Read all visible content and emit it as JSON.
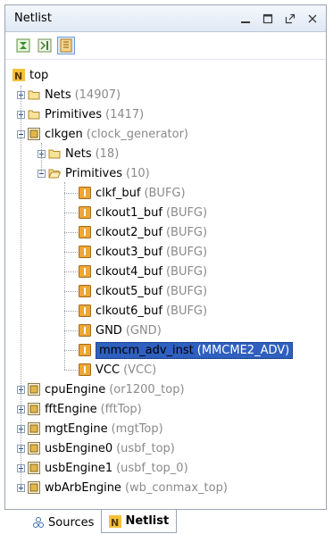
{
  "panel": {
    "title": "Netlist",
    "window_buttons": [
      "minimize-icon",
      "restore-icon",
      "float-icon",
      "close-icon"
    ]
  },
  "toolbar": {
    "buttons": [
      {
        "name": "collapse-all-icon",
        "active": false
      },
      {
        "name": "expand-icon",
        "active": false
      },
      {
        "name": "show-hierarchy-icon",
        "active": true
      }
    ]
  },
  "tree": {
    "root": "top",
    "top_nets": {
      "name": "Nets",
      "type": "(14907)"
    },
    "top_primitives": {
      "name": "Primitives",
      "type": "(1417)"
    },
    "clkgen": {
      "name": "clkgen",
      "type": "(clock_generator)"
    },
    "clkgen_nets": {
      "name": "Nets",
      "type": "(18)"
    },
    "clkgen_primitives": {
      "name": "Primitives",
      "type": "(10)"
    },
    "primitives": [
      {
        "name": "clkf_buf",
        "type": "(BUFG)"
      },
      {
        "name": "clkout1_buf",
        "type": "(BUFG)"
      },
      {
        "name": "clkout2_buf",
        "type": "(BUFG)"
      },
      {
        "name": "clkout3_buf",
        "type": "(BUFG)"
      },
      {
        "name": "clkout4_buf",
        "type": "(BUFG)"
      },
      {
        "name": "clkout5_buf",
        "type": "(BUFG)"
      },
      {
        "name": "clkout6_buf",
        "type": "(BUFG)"
      },
      {
        "name": "GND",
        "type": "(GND)"
      },
      {
        "name": "mmcm_adv_inst",
        "type": "(MMCME2_ADV)"
      },
      {
        "name": "VCC",
        "type": "(VCC)"
      }
    ],
    "modules": [
      {
        "name": "cpuEngine",
        "type": "(or1200_top)"
      },
      {
        "name": "fftEngine",
        "type": "(fftTop)"
      },
      {
        "name": "mgtEngine",
        "type": "(mgtTop)"
      },
      {
        "name": "usbEngine0",
        "type": "(usbf_top)"
      },
      {
        "name": "usbEngine1",
        "type": "(usbf_top_0)"
      },
      {
        "name": "wbArbEngine",
        "type": "(wb_conmax_top)"
      }
    ]
  },
  "tabs": [
    {
      "label": "Sources",
      "active": false
    },
    {
      "label": "Netlist",
      "active": true
    }
  ],
  "colors": {
    "selection": "#2f5fbf",
    "type_text": "#8a8a8a",
    "leaf_icon": "#e8a22a",
    "module_icon": "#d9a43a"
  }
}
